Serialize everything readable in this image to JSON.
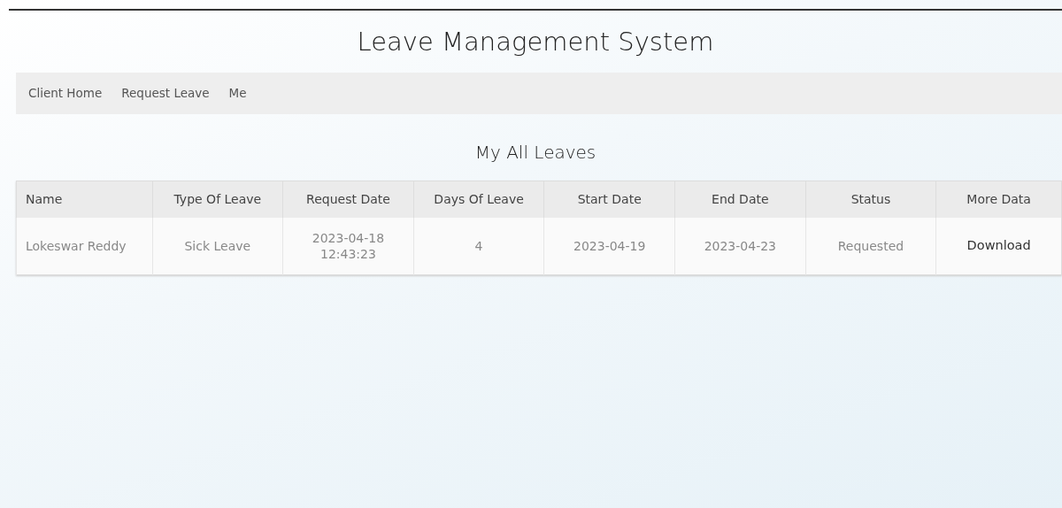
{
  "header": {
    "title": "Leave Management System"
  },
  "nav": {
    "items": [
      {
        "label": "Client Home"
      },
      {
        "label": "Request Leave"
      },
      {
        "label": "Me"
      }
    ]
  },
  "section_title": "My All Leaves",
  "table": {
    "columns": [
      "Name",
      "Type Of Leave",
      "Request Date",
      "Days Of Leave",
      "Start Date",
      "End Date",
      "Status",
      "More Data"
    ],
    "rows": [
      {
        "cells": [
          "Lokeswar Reddy",
          "Sick Leave",
          "2023-04-18 12:43:23",
          "4",
          "2023-04-19",
          "2023-04-23",
          "Requested"
        ],
        "link": "Download"
      }
    ]
  }
}
